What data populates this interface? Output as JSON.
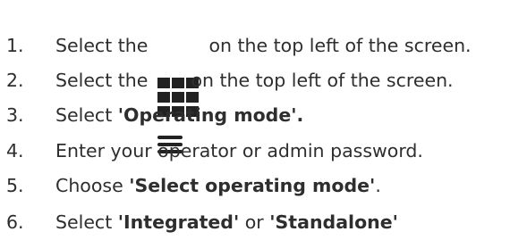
{
  "steps": [
    {
      "number": "1.",
      "text_before": "Select the ",
      "icon": "grid-icon",
      "text_after": " on the top left of the screen."
    },
    {
      "number": "2.",
      "text_before": "Select the ",
      "icon": "hamburger-menu-icon",
      "text_after": " on the top left of the screen."
    },
    {
      "number": "3.",
      "text_before": "Select ",
      "bold": "'Operating mode'."
    },
    {
      "number": "4.",
      "text": "Enter your operator or admin password."
    },
    {
      "number": "5.",
      "text_before": "Choose ",
      "bold": "'Select operating mode'",
      "text_after": "."
    },
    {
      "number": "6.",
      "text_before": "Select ",
      "bold": "'Integrated'",
      "text_middle": " or ",
      "bold2": "'Standalone'"
    }
  ],
  "colors": {
    "text": "#2e2e2e",
    "icon": "#222222",
    "background": "#ffffff"
  }
}
